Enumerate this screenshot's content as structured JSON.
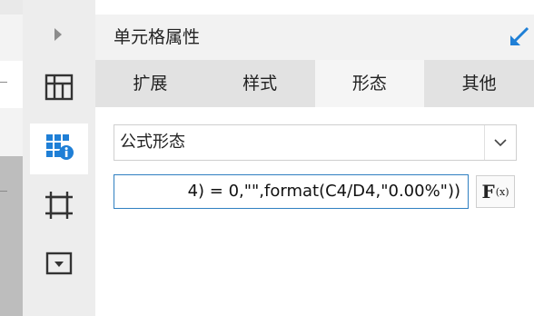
{
  "panel": {
    "title": "单元格属性",
    "tabs": [
      {
        "label": "扩展",
        "active": false
      },
      {
        "label": "样式",
        "active": false
      },
      {
        "label": "形态",
        "active": true
      },
      {
        "label": "其他",
        "active": false
      }
    ]
  },
  "form": {
    "type_select_value": "公式形态",
    "formula_value": "4) = 0,\"\",format(C4/D4,\"0.00%\"))",
    "formula_button_label": "F",
    "formula_button_sub": "(x)"
  },
  "icons": {
    "collapse": "chevron-right-icon",
    "pin": "pin-arrow-icon",
    "sidebar": [
      "cell-expand-icon",
      "cell-attribute-icon",
      "widget-icon",
      "dropdown-widget-icon"
    ]
  },
  "colors": {
    "accent": "#2f7fc1",
    "active_icon": "#1f7fd6"
  }
}
